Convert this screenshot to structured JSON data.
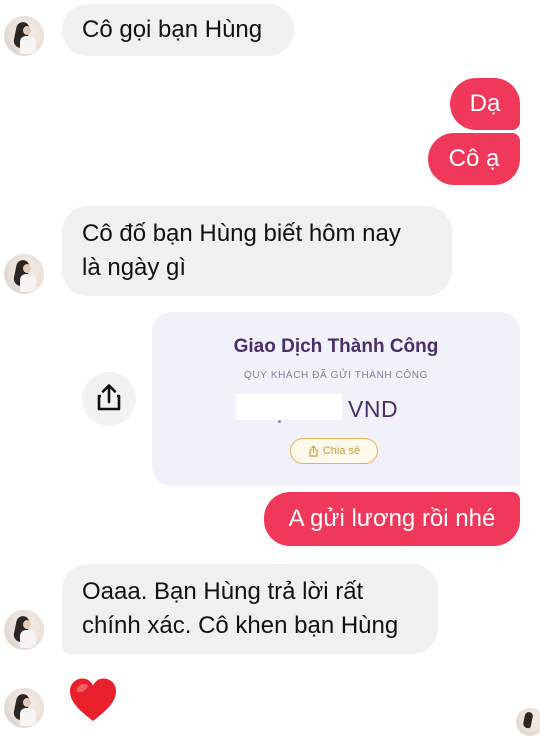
{
  "conversation": {
    "messages": [
      {
        "side": "incoming",
        "text": "Cô gọi bạn Hùng"
      },
      {
        "side": "outgoing",
        "text": "Dạ"
      },
      {
        "side": "outgoing",
        "text": "Cô ạ"
      },
      {
        "side": "incoming",
        "lines": [
          "Cô đố bạn Hùng biết hôm nay",
          "là ngày gì"
        ]
      },
      {
        "side": "outgoing",
        "text": "A gửi lương rồi nhé"
      },
      {
        "side": "incoming",
        "lines": [
          "Oaaa. Bạn Hùng trả lời rất",
          "chính xác. Cô khen bạn Hùng"
        ]
      },
      {
        "side": "incoming",
        "icon": "heart-emoji"
      }
    ]
  },
  "receipt": {
    "title": "Giao Dịch Thành Công",
    "subtitle": "QUÝ KHÁCH ĐÃ GỬI THÀNH CÔNG",
    "amount": "",
    "currency": "VND",
    "share_label": "Chia sẻ"
  },
  "icons": {
    "share_button": "share-icon",
    "avatar": "avatar-icon",
    "reaction": "heart-emoji"
  },
  "colors": {
    "incoming_bubble": "#f0f0f0",
    "outgoing_bubble": "#f0395a",
    "receipt_bg": "#f1f2f9",
    "receipt_title": "#4a2e6b",
    "share_chip_border": "#e7b25a"
  }
}
